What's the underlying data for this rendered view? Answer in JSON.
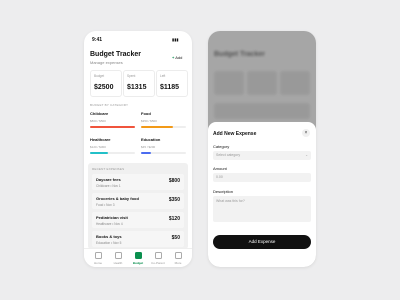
{
  "left": {
    "status_time": "9:41",
    "title": "Budget Tracker",
    "subtitle": "Manage expenses",
    "add_label": "Add",
    "summary": [
      {
        "label": "Budget",
        "value": "$2500"
      },
      {
        "label": "Spent",
        "value": "$1315"
      },
      {
        "label": "Left",
        "value": "$1185"
      }
    ],
    "category_heading": "BUDGET BY CATEGORY",
    "categories": [
      {
        "name": "Childcare",
        "value": "$800 / $500",
        "color": "#f0543c",
        "progress": 1.0
      },
      {
        "name": "Food",
        "value": "$350 / $500",
        "color": "#f29a18",
        "progress": 0.7
      },
      {
        "name": "Healthcare",
        "value": "$120 / $300",
        "color": "#22c0c8",
        "progress": 0.4
      },
      {
        "name": "Education",
        "value": "$45 / $200",
        "color": "#4b6cf0",
        "progress": 0.23
      }
    ],
    "recent_heading": "RECENT EXPENSES",
    "expenses": [
      {
        "name": "Daycare fees",
        "meta": "Childcare • Nov 1",
        "amount": "$800"
      },
      {
        "name": "Groceries & baby food",
        "meta": "Food • Nov 3",
        "amount": "$350"
      },
      {
        "name": "Pediatrician visit",
        "meta": "Healthcare • Nov 4",
        "amount": "$120"
      },
      {
        "name": "Books & toys",
        "meta": "Education • Nov 5",
        "amount": "$50"
      }
    ],
    "nav": [
      "Home",
      "Health",
      "Budget",
      "Co-Parent",
      "More"
    ],
    "accent": "#0a8f4e"
  },
  "right": {
    "bg_title": "Budget Tracker",
    "sheet_title": "Add New Expense",
    "category_label": "Category",
    "category_placeholder": "Select category",
    "amount_label": "Amount",
    "amount_placeholder": "0.00",
    "description_label": "Description",
    "description_placeholder": "What was this for?",
    "button_label": "Add Expense"
  }
}
